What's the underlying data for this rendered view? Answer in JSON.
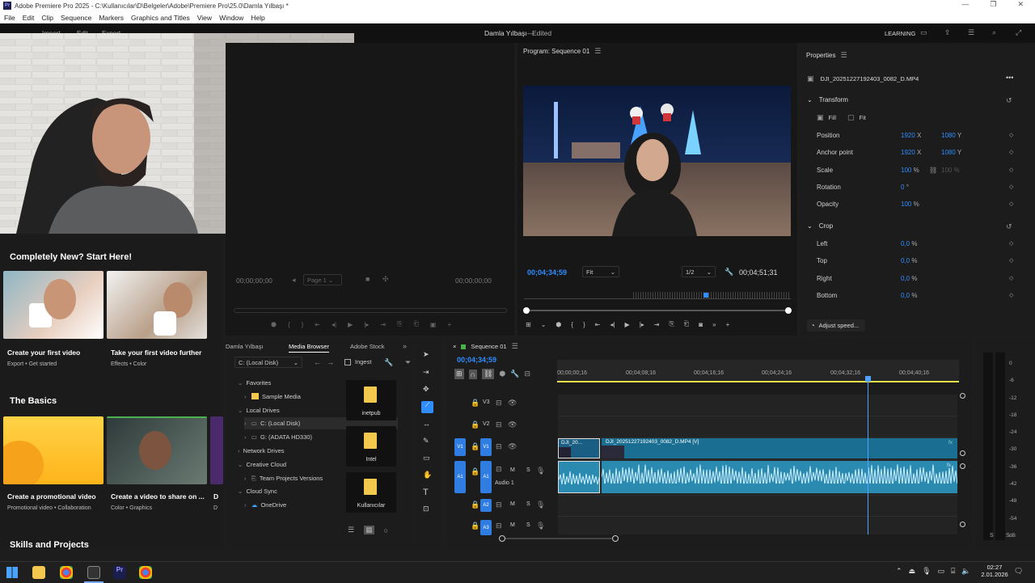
{
  "window": {
    "title": "Adobe Premiere Pro 2025 - C:\\Kullanıcılar\\D\\Belgeler\\Adobe\\Premiere Pro\\25.0\\Damla Yılbaşı *",
    "app_icon": "Pr"
  },
  "menu": [
    "File",
    "Edit",
    "Clip",
    "Sequence",
    "Markers",
    "Graphics and Titles",
    "View",
    "Window",
    "Help"
  ],
  "header": {
    "tabs": [
      "Import",
      "Edit",
      "Export"
    ],
    "project_title": "Damla Yılbaşı",
    "status": "Edited",
    "workspace": "LEARNING"
  },
  "learn": {
    "section1": "Completely New? Start Here!",
    "cards1": [
      {
        "title": "Create your first video",
        "sub": "Export  •  Get started"
      },
      {
        "title": "Take your first video further",
        "sub": "Effects  •  Color"
      }
    ],
    "section2": "The Basics",
    "cards2": [
      {
        "title": "Create a promotional video",
        "sub": "Promotional video  •  Collaboration"
      },
      {
        "title": "Create a video to share on ...",
        "sub": "Color  •  Graphics"
      },
      {
        "title": "D",
        "sub": "D"
      }
    ],
    "section3": "Skills and Projects"
  },
  "source_monitor": {
    "timecode_left": "00;00;00;00",
    "page": "Page 1",
    "timecode_right": "00;00;00;00"
  },
  "program": {
    "title": "Program: Sequence 01",
    "timecode": "00;04;34;59",
    "fit": "Fit",
    "res": "1/2",
    "duration": "00;04;51;31"
  },
  "properties": {
    "title": "Properties",
    "clip": "DJI_20251227192403_0082_D.MP4",
    "transform_label": "Transform",
    "fill_label": "Fill",
    "fit_label": "Fit",
    "rows": [
      {
        "label": "Position",
        "v1": "1920",
        "u1": "X",
        "v2": "1080",
        "u2": "Y"
      },
      {
        "label": "Anchor point",
        "v1": "1920",
        "u1": "X",
        "v2": "1080",
        "u2": "Y"
      },
      {
        "label": "Scale",
        "v1": "100",
        "u1": "%",
        "v2": "100",
        "u2": "%"
      },
      {
        "label": "Rotation",
        "v1": "0",
        "u1": "°",
        "v2": "",
        "u2": ""
      },
      {
        "label": "Opacity",
        "v1": "100",
        "u1": "%",
        "v2": "",
        "u2": ""
      }
    ],
    "crop_label": "Crop",
    "crop_rows": [
      {
        "label": "Left",
        "v1": "0,0",
        "u1": "%"
      },
      {
        "label": "Top",
        "v1": "0,0",
        "u1": "%"
      },
      {
        "label": "Right",
        "v1": "0,0",
        "u1": "%"
      },
      {
        "label": "Bottom",
        "v1": "0,0",
        "u1": "%"
      }
    ],
    "adjust_speed": "Adjust speed..."
  },
  "media_browser": {
    "tabs": [
      "Damla Yılbaşı",
      "Media Browser",
      "Adobe Stock"
    ],
    "drive": "C: (Local Disk)",
    "ingest": "Ingest",
    "tree": [
      {
        "label": "Favorites",
        "level": 0
      },
      {
        "label": "Sample Media",
        "level": 1
      },
      {
        "label": "Local Drives",
        "level": 0
      },
      {
        "label": "C: (Local Disk)",
        "level": 1
      },
      {
        "label": "G: (ADATA HD330)",
        "level": 1
      },
      {
        "label": "Network Drives",
        "level": 0
      },
      {
        "label": "Creative Cloud",
        "level": 0
      },
      {
        "label": "Team Projects Versions",
        "level": 1
      },
      {
        "label": "Cloud Sync",
        "level": 0
      },
      {
        "label": "OneDrive",
        "level": 1
      }
    ],
    "folders": [
      "inetpub",
      "Intel",
      "Kullanıcılar"
    ]
  },
  "timeline": {
    "tab": "Sequence 01",
    "timecode": "00;04;34;59",
    "ruler": [
      "00;00;00;16",
      "00;04;08;16",
      "00;04;16;16",
      "00;04;24;16",
      "00;04;32;16",
      "00;04;40;16"
    ],
    "video_tracks": [
      "V3",
      "V2",
      "V1"
    ],
    "audio_tracks": [
      "A1",
      "A2",
      "A3"
    ],
    "audio1_name": "Audio 1",
    "clip_short": "DJI_20...",
    "clip_long": "DJI_20251227192403_0082_D.MP4 [V]",
    "mute": "M",
    "solo": "S"
  },
  "meter": {
    "ticks": [
      "0",
      "-6",
      "-12",
      "-18",
      "-24",
      "-30",
      "-36",
      "-42",
      "-48",
      "-54",
      "dB"
    ],
    "solo": [
      "S",
      "S"
    ]
  },
  "taskbar": {
    "time": "02:27",
    "date": "2.01.2026"
  }
}
